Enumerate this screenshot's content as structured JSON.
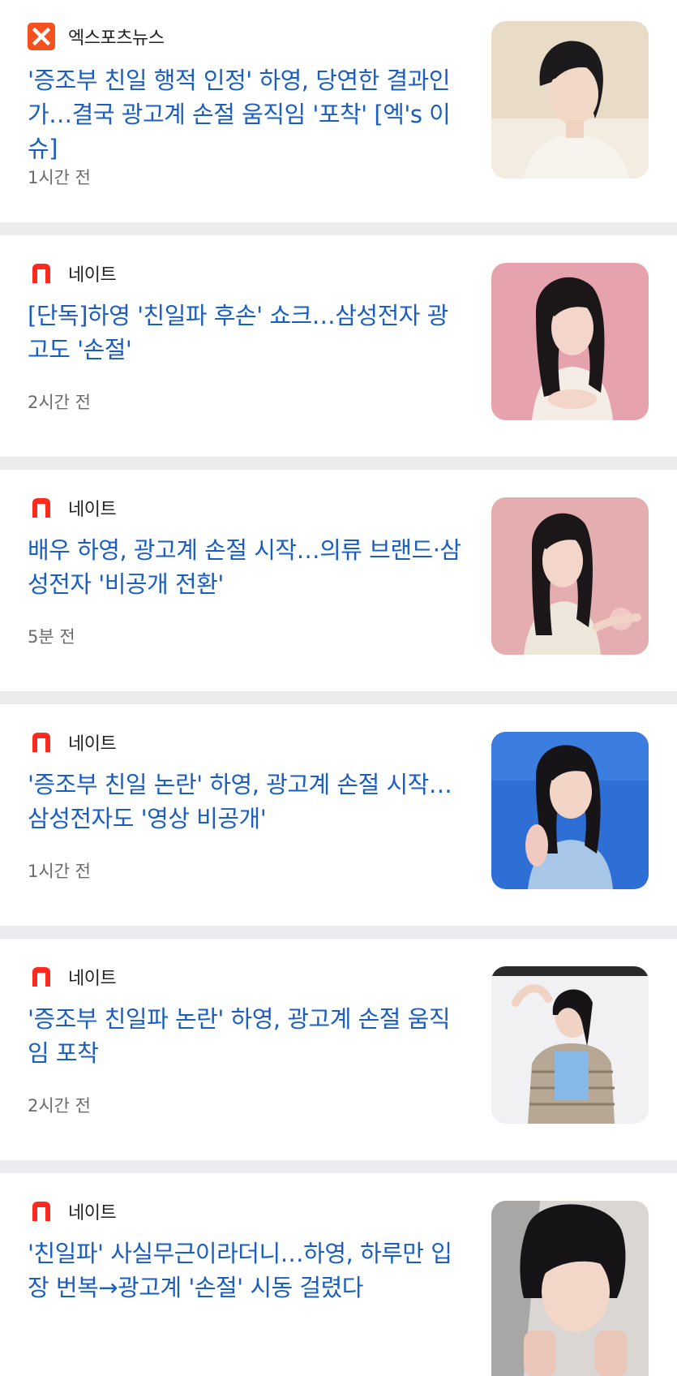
{
  "articles": [
    {
      "source": "엑스포츠뉴스",
      "logo": "x-logo",
      "headline": "'증조부 친일 행적 인정' 하영, 당연한 결과인가…결국 광고계 손절 움직임 '포착' [엑's 이슈]",
      "time": "1시간 전"
    },
    {
      "source": "네이트",
      "logo": "nate-logo",
      "headline": "[단독]하영 '친일파 후손' 쇼크…삼성전자 광고도 '손절'",
      "time": "2시간 전"
    },
    {
      "source": "네이트",
      "logo": "nate-logo",
      "headline": "배우 하영, 광고계 손절 시작…의류 브랜드·삼성전자 '비공개 전환'",
      "time": "5분 전"
    },
    {
      "source": "네이트",
      "logo": "nate-logo",
      "headline": "'증조부 친일 논란' 하영, 광고계 손절 시작…삼성전자도 '영상 비공개'",
      "time": "1시간 전"
    },
    {
      "source": "네이트",
      "logo": "nate-logo",
      "headline": "'증조부 친일파 논란' 하영, 광고계 손절 움직임 포착",
      "time": "2시간 전"
    },
    {
      "source": "네이트",
      "logo": "nate-logo",
      "headline": "'친일파' 사실무근이라더니…하영, 하루만 입장 번복→광고계 '손절' 시동 걸렸다",
      "time": ""
    }
  ],
  "colors": {
    "headline": "#1a5fc0",
    "xLogo": "#f4511e",
    "nateLogo": "#ff2a1f",
    "divider": "#ececef"
  }
}
